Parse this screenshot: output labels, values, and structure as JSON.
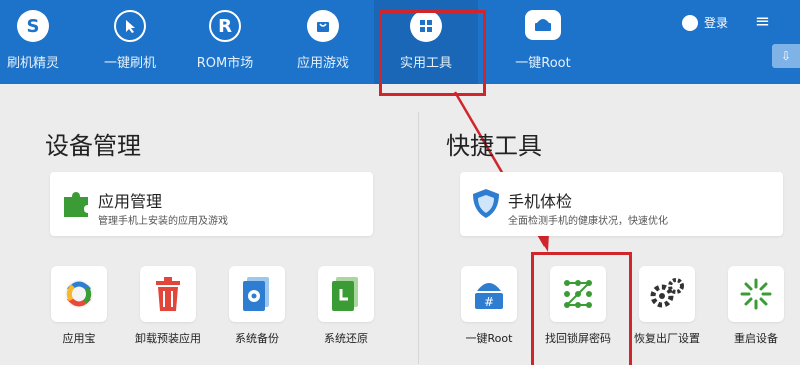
{
  "header": {
    "tabs": [
      {
        "label": "刷机精灵",
        "icon": "shield-s-icon"
      },
      {
        "label": "一键刷机",
        "icon": "cursor-icon"
      },
      {
        "label": "ROM市场",
        "icon": "r-letter-icon"
      },
      {
        "label": "应用游戏",
        "icon": "bag-icon"
      },
      {
        "label": "实用工具",
        "icon": "grid-icon"
      },
      {
        "label": "一键Root",
        "icon": "android-robot-icon"
      }
    ],
    "active_tab": "实用工具",
    "login_label": "登录",
    "menu_glyph": "≡",
    "download_glyph": "⇩"
  },
  "device_mgmt": {
    "title": "设备管理",
    "card": {
      "title": "应用管理",
      "desc": "管理手机上安装的应用及游戏"
    },
    "tools": [
      {
        "label": "应用宝",
        "icon": "yingyongbao-icon"
      },
      {
        "label": "卸载预装应用",
        "icon": "trash-icon"
      },
      {
        "label": "系统备份",
        "icon": "backup-gear-icon"
      },
      {
        "label": "系统还原",
        "icon": "restore-clock-icon"
      }
    ]
  },
  "quick_tools": {
    "title": "快捷工具",
    "card": {
      "title": "手机体检",
      "desc": "全面检测手机的健康状况，快速优化"
    },
    "tools": [
      {
        "label": "一键Root",
        "icon": "android-root-icon"
      },
      {
        "label": "找回锁屏密码",
        "icon": "pattern-lock-icon"
      },
      {
        "label": "恢复出厂设置",
        "icon": "gears-icon"
      },
      {
        "label": "重启设备",
        "icon": "restart-spinner-icon"
      }
    ]
  },
  "colors": {
    "topbar": "#1c73c9",
    "highlight": "#d0262b",
    "green": "#3b9c35",
    "blue": "#2f7dd1"
  }
}
